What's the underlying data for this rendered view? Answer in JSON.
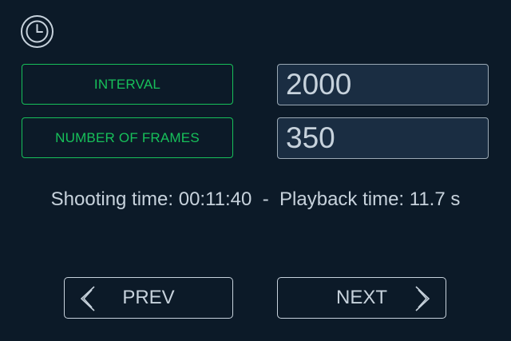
{
  "header": {
    "icon": "clock-icon"
  },
  "settings": {
    "interval": {
      "label": "INTERVAL",
      "value": "2000"
    },
    "frames": {
      "label": "NUMBER OF FRAMES",
      "value": "350"
    }
  },
  "info": {
    "text": "Shooting time: 00:11:40  -  Playback time: 11.7 s"
  },
  "navigation": {
    "prev_label": "PREV",
    "next_label": "NEXT"
  },
  "colors": {
    "background": "#0c1a28",
    "accent": "#17c05a",
    "text": "#c7d2dc",
    "field_bg": "#1a2d42"
  }
}
